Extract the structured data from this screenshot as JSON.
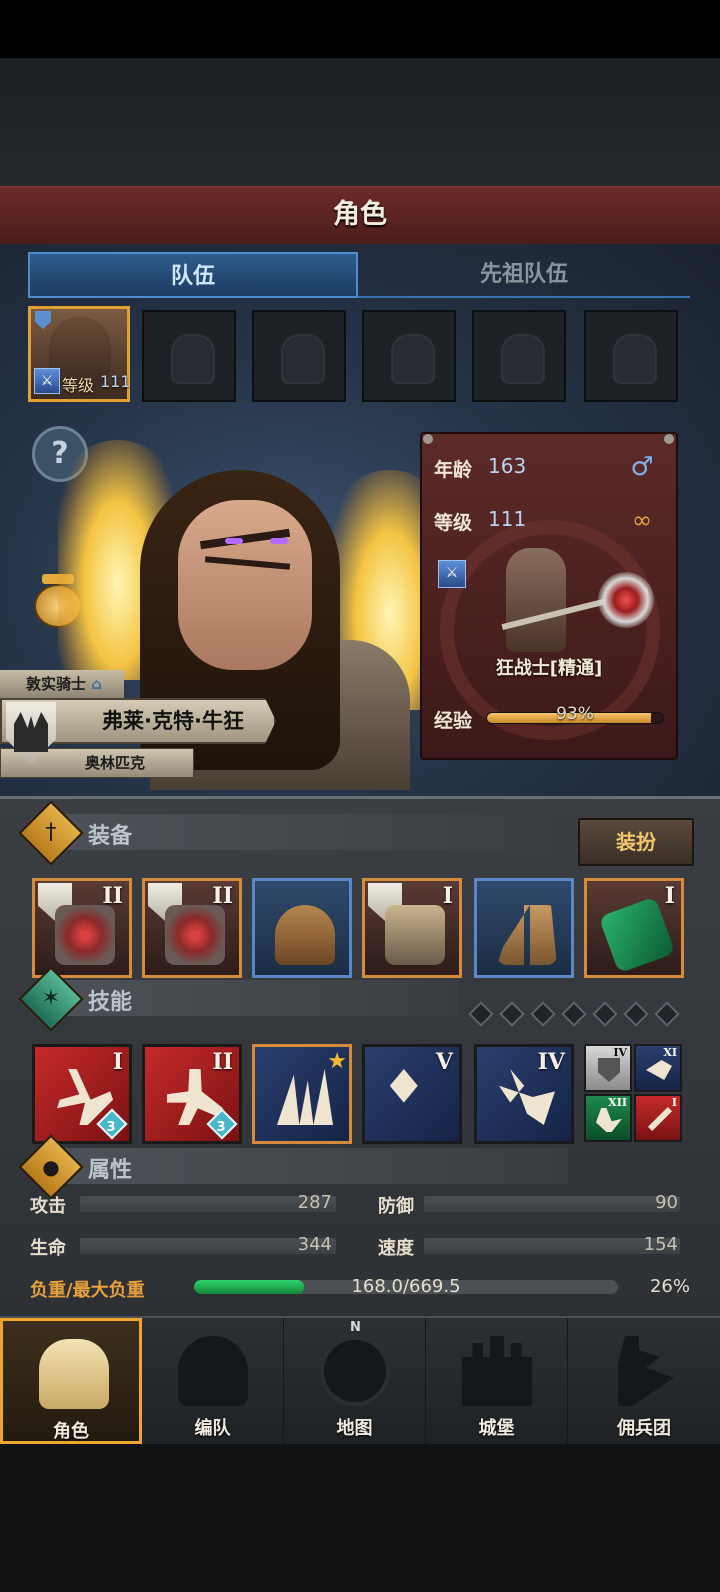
{
  "header": {
    "title": "角色"
  },
  "tabs": [
    {
      "label": "队伍",
      "active": true
    },
    {
      "label": "先祖队伍",
      "active": false
    }
  ],
  "team": {
    "active_level_label": "等级",
    "active_level_value": "111",
    "empty_slots": 5
  },
  "hero": {
    "title": "敦实骑士",
    "name": "弗莱·克特·牛狂",
    "origin": "奥林匹克"
  },
  "info_card": {
    "age_label": "年龄",
    "age_value": "163",
    "gender_icon": "male-icon",
    "level_label": "等级",
    "level_value": "111",
    "class_name": "狂战士[精通]",
    "exp_label": "经验",
    "exp_percent_text": "93%",
    "exp_fraction": 0.93
  },
  "equipment": {
    "title": "装备",
    "dress_button": "装扮",
    "items": [
      {
        "tier": "II",
        "frame": "orange",
        "icon": "mace-icon"
      },
      {
        "tier": "II",
        "frame": "orange",
        "icon": "mace-icon"
      },
      {
        "tier": "",
        "frame": "blue",
        "icon": "helmet-icon"
      },
      {
        "tier": "I",
        "frame": "orange",
        "icon": "fur-armor-icon"
      },
      {
        "tier": "",
        "frame": "blue",
        "icon": "boots-icon"
      },
      {
        "tier": "I",
        "frame": "orange",
        "icon": "emerald-gauntlet-icon"
      }
    ]
  },
  "skills": {
    "title": "技能",
    "slots_total": 7,
    "items": [
      {
        "tier": "I",
        "badge": "3",
        "icon": "axe-strike-icon"
      },
      {
        "tier": "II",
        "badge": "3",
        "icon": "rally-icon"
      },
      {
        "tier": "",
        "badge": "",
        "icon": "claw-slash-icon",
        "starred": true
      },
      {
        "tier": "V",
        "badge": "",
        "icon": "crystal-sword-icon"
      },
      {
        "tier": "IV",
        "badge": "",
        "icon": "crystal-beast-icon"
      }
    ],
    "mini": [
      {
        "tier": "IV",
        "icon": "shield-buff-icon"
      },
      {
        "tier": "XI",
        "icon": "beast-icon"
      },
      {
        "tier": "XII",
        "icon": "strike-icon"
      },
      {
        "tier": "I",
        "icon": "sword-icon"
      }
    ]
  },
  "attributes": {
    "title": "属性",
    "attack_label": "攻击",
    "attack_value": "287",
    "defense_label": "防御",
    "defense_value": "90",
    "hp_label": "生命",
    "hp_value": "344",
    "speed_label": "速度",
    "speed_value": "154",
    "load_label": "负重/最大负重",
    "load_value": "168.0/669.5",
    "load_percent": "26%",
    "load_fraction": 0.26
  },
  "nav": {
    "compass_label": "N",
    "items": [
      {
        "label": "角色",
        "active": true
      },
      {
        "label": "编队",
        "active": false
      },
      {
        "label": "地图",
        "active": false
      },
      {
        "label": "城堡",
        "active": false
      },
      {
        "label": "佣兵团",
        "active": false
      }
    ]
  },
  "colors": {
    "title_bar": "#5b2422",
    "tab_active": "#2e5d8c",
    "accent_gold": "#f0a52c",
    "exp_bar": "#e9b04f",
    "load_bar": "#22b455"
  }
}
